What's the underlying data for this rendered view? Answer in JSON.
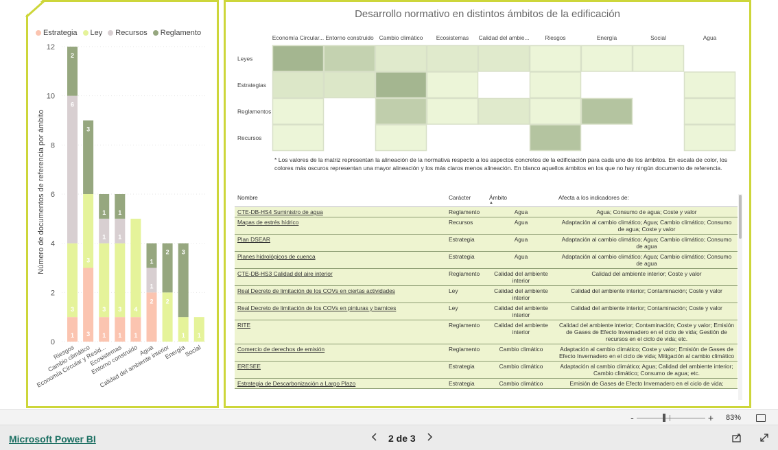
{
  "left_chart": {
    "legend": [
      {
        "name": "Estrategia",
        "color": "#fbc4b0"
      },
      {
        "name": "Ley",
        "color": "#e5f39a"
      },
      {
        "name": "Recursos",
        "color": "#d8cfd1"
      },
      {
        "name": "Reglamento",
        "color": "#96a77f"
      }
    ],
    "ylabel": "Número de documentos de referencia por ámbito"
  },
  "chart_data": {
    "type": "bar",
    "stacked": true,
    "categories": [
      "Riesgos",
      "Cambio climático",
      "Economía Circular y Resid...",
      "Ecosistemas",
      "Entorno construido",
      "Agua",
      "Calidad del ambiente interior",
      "Energía",
      "Social"
    ],
    "series": [
      {
        "name": "Estrategia",
        "color": "#fbc4b0",
        "values": [
          1,
          3,
          1,
          1,
          1,
          2,
          0,
          0,
          0
        ]
      },
      {
        "name": "Ley",
        "color": "#e5f39a",
        "values": [
          3,
          3,
          3,
          3,
          4,
          0,
          2,
          1,
          1
        ]
      },
      {
        "name": "Recursos",
        "color": "#d8cfd1",
        "values": [
          6,
          0,
          1,
          1,
          0,
          1,
          0,
          0,
          0
        ]
      },
      {
        "name": "Reglamento",
        "color": "#96a77f",
        "values": [
          2,
          3,
          1,
          1,
          0,
          1,
          2,
          3,
          0
        ]
      }
    ],
    "ylim": [
      0,
      12
    ],
    "yticks": [
      0,
      2,
      4,
      6,
      8,
      10,
      12
    ],
    "ylabel": "Número de documentos de referencia por ámbito",
    "legend": "top"
  },
  "title": "Desarrollo normativo en distintos ámbitos de la edificación",
  "matrix": {
    "columns": [
      "Economía Circular...",
      "Entorno construido",
      "Cambio climático",
      "Ecosistemas",
      "Calidad del ambie...",
      "Riesgos",
      "Energía",
      "Social",
      "Agua"
    ],
    "rows": [
      "Leyes",
      "Estrategias",
      "Reglamentos",
      "Recursos"
    ],
    "values": [
      [
        0.95,
        0.55,
        0.2,
        0.2,
        0.2,
        0.05,
        0.05,
        0.05,
        null
      ],
      [
        0.25,
        0.25,
        0.95,
        0.05,
        null,
        0.05,
        null,
        null,
        0.05
      ],
      [
        0.05,
        null,
        0.6,
        0.05,
        0.2,
        0.05,
        0.75,
        null,
        0.05
      ],
      [
        0.05,
        null,
        0.05,
        null,
        null,
        0.75,
        null,
        null,
        0.05
      ]
    ]
  },
  "note": "* Los valores de la matriz representan la alineación de la normativa respecto a los aspectos concretos de la edificiación para cada uno de los ámbitos. En escala de color, los colores más oscuros representan una mayor alineación y los más claros menos alineación. En blanco aquellos ámbitos en los que no hay ningún documento de referencia.",
  "table": {
    "headers": [
      "Nombre",
      "Carácter",
      "Ámbito",
      "Afecta a los indicadores de:"
    ],
    "rows": [
      [
        "CTE-DB-HS4 Suministro de agua",
        "Reglamento",
        "Agua",
        "Agua; Consumo de agua; Coste y valor"
      ],
      [
        "Mapas de estrés hídrico",
        "Recursos",
        "Agua",
        "Adaptación al cambio climático; Agua; Cambio climático; Consumo de agua; Coste y valor"
      ],
      [
        "Plan DSEAR",
        "Estrategia",
        "Agua",
        "Adaptación al cambio climático; Agua; Cambio climático; Consumo de agua"
      ],
      [
        "Planes hidrológicos de cuenca",
        "Estrategia",
        "Agua",
        "Adaptación al cambio climático; Agua; Cambio climático; Consumo de agua"
      ],
      [
        "CTE-DB-HS3 Calidad del aire interior",
        "Reglamento",
        "Calidad del ambiente interior",
        "Calidad del ambiente interior; Coste y valor"
      ],
      [
        "Real Decreto de limitación de los COVs en ciertas actividades",
        "Ley",
        "Calidad del ambiente interior",
        "Calidad del ambiente interior; Contaminación; Coste y valor"
      ],
      [
        "Real Decreto de limitación de los COVs en pinturas y barnices",
        "Ley",
        "Calidad del ambiente interior",
        "Calidad del ambiente interior; Contaminación; Coste y valor"
      ],
      [
        "RITE",
        "Reglamento",
        "Calidad del ambiente interior",
        "Calidad del ambiente interior; Contaminación; Coste y valor; Emisión de Gases de Efecto Invernadero en el ciclo de vida; Gestión de recursos en el ciclo de vida; etc."
      ],
      [
        "Comercio de derechos de emisión",
        "Reglamento",
        "Cambio climático",
        "Adaptación al cambio climático; Coste y valor; Emisión de Gases de Efecto Invernadero en el ciclo de vida; Mitigación al cambio climático"
      ],
      [
        "ERESEE",
        "Estrategia",
        "Cambio climático",
        "Adaptación al cambio climático; Agua; Calidad del ambiente interior; Cambio climático; Consumo de agua; etc."
      ],
      [
        "Estrategia de Descarbonización a Largo Plazo",
        "Estrategia",
        "Cambio climático",
        "Emisión de Gases de Efecto Invernadero en el ciclo de vida;"
      ]
    ]
  },
  "zoom": {
    "minus": "-",
    "plus": "+",
    "level": "83%"
  },
  "footer": {
    "brand": "Microsoft Power BI",
    "page": "2 de 3"
  },
  "icons": [
    "fit-page-icon",
    "chevron-left-icon",
    "chevron-right-icon",
    "share-icon",
    "fullscreen-icon",
    "sort-asc-icon"
  ]
}
